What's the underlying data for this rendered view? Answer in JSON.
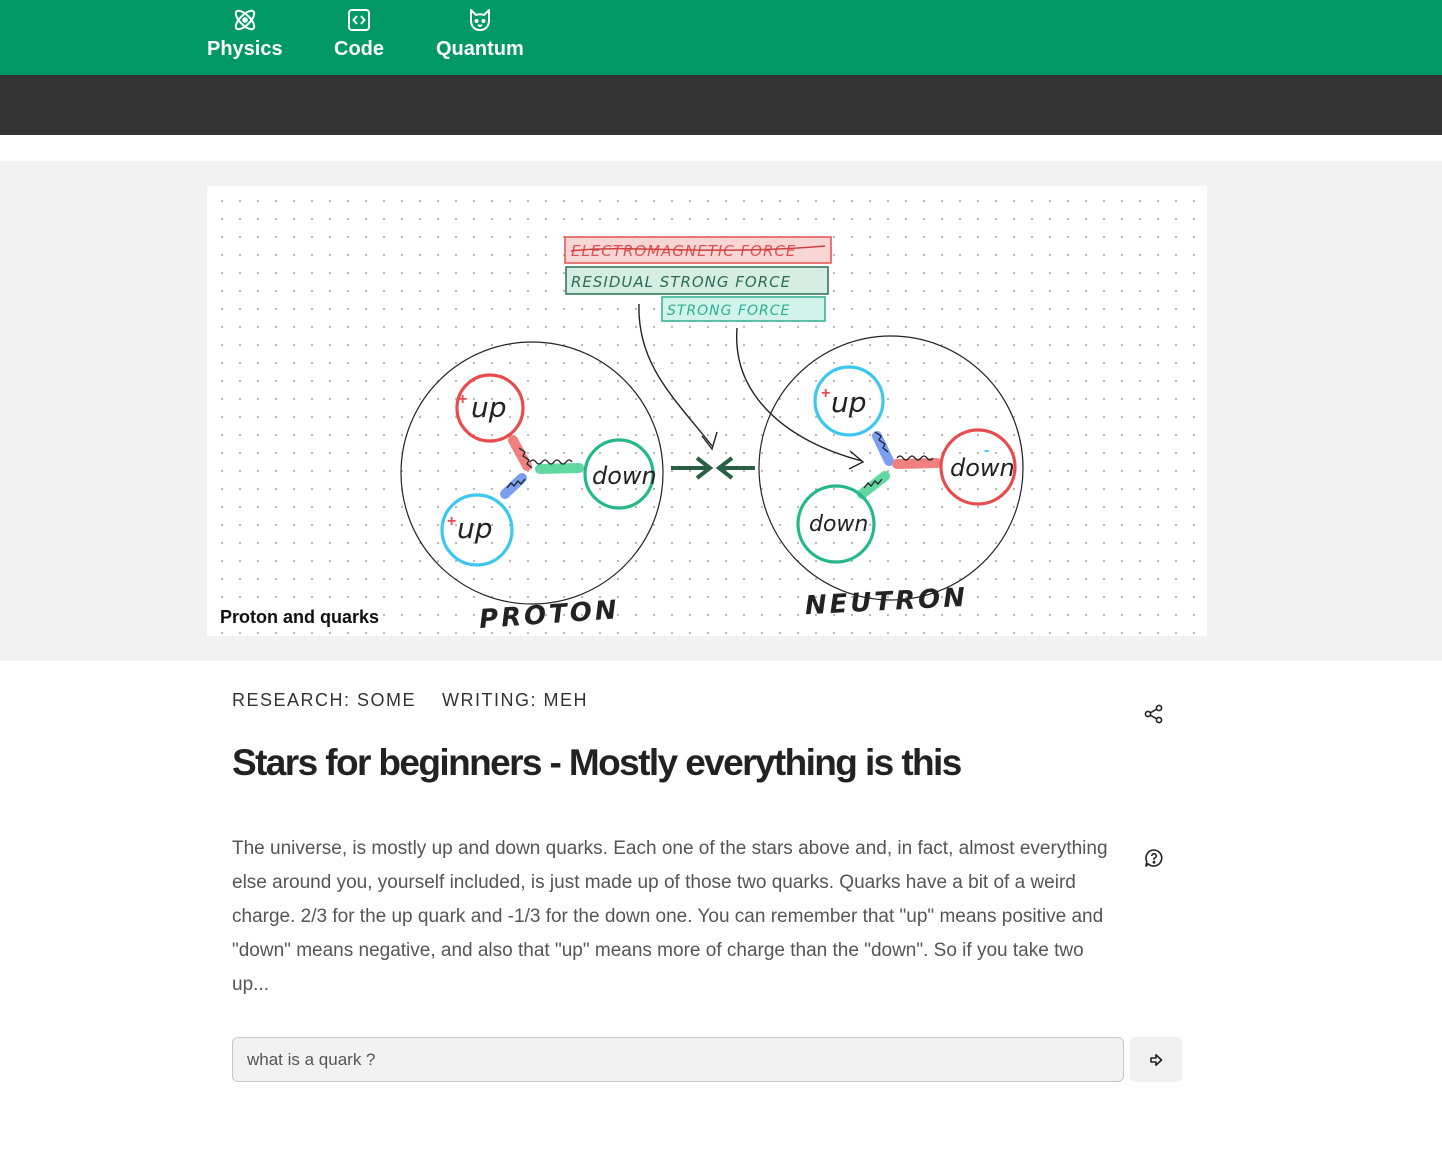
{
  "nav": {
    "items": [
      {
        "label": "Physics",
        "icon": "atom-icon"
      },
      {
        "label": "Code",
        "icon": "code-icon"
      },
      {
        "label": "Quantum",
        "icon": "cat-icon"
      }
    ],
    "colors": {
      "nav_bg": "#009966",
      "dark_bar": "#333333"
    }
  },
  "figure": {
    "caption": "Proton and quarks",
    "legend": {
      "electromagnetic": "ELECTROMAGNETIC FORCE",
      "residual": "RESIDUAL STRONG FORCE",
      "strong": "STRONG FORCE"
    },
    "proton": {
      "label": "PROTON",
      "quarks": [
        {
          "label": "up",
          "color": "#e84c4c",
          "charge": "+"
        },
        {
          "label": "down",
          "color": "#26b88a"
        },
        {
          "label": "up",
          "color": "#3cc8ee",
          "charge": "+"
        }
      ]
    },
    "neutron": {
      "label": "NEUTRON",
      "quarks": [
        {
          "label": "up",
          "color": "#3cc8ee",
          "charge": "+"
        },
        {
          "label": "down",
          "color": "#e84c4c",
          "charge": "-"
        },
        {
          "label": "down",
          "color": "#26b88a"
        }
      ]
    }
  },
  "article": {
    "tags": [
      "RESEARCH: SOME",
      "WRITING: MEH"
    ],
    "title": "Stars for beginners - Mostly everything is this",
    "body": "The universe, is mostly up and down quarks. Each one of the stars above and, in fact, almost everything else around you, yourself included, is just made up of those two quarks. Quarks have a bit of a weird charge. 2/3 for the up quark and -1/3 for the down one. You can remember that \"up\" means positive and \"down\" means negative, and also that \"up\" means more of charge than the \"down\". So if you take two up..."
  },
  "ask": {
    "placeholder": "what is a quark ?",
    "value": ""
  }
}
